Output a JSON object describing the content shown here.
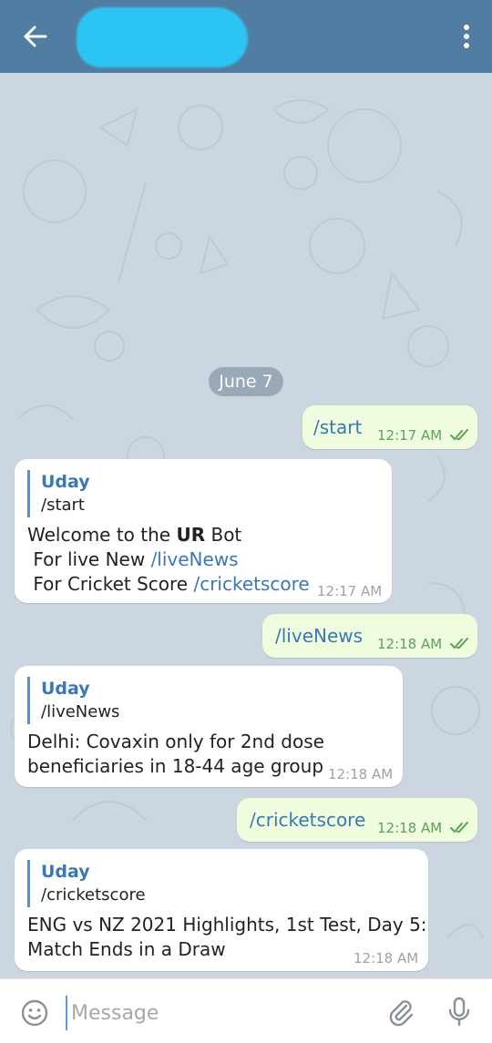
{
  "header": {
    "back_icon": "arrow-left-icon",
    "menu_icon": "more-vertical-icon",
    "color": "#517da2"
  },
  "chat": {
    "date_badge": "June 7",
    "messages": [
      {
        "direction": "out",
        "text": "/start",
        "time": "12:17 AM"
      },
      {
        "direction": "in",
        "reply_name": "Uday",
        "reply_text": "/start",
        "line1_prefix": "Welcome to the ",
        "line1_bold": "UR",
        "line1_suffix": " Bot",
        "line2_prefix": " For live New ",
        "line2_cmd": "/liveNews",
        "line3_prefix": " For Cricket Score ",
        "line3_cmd": "/cricketscore",
        "time": "12:17 AM"
      },
      {
        "direction": "out",
        "text": "/liveNews",
        "time": "12:18 AM"
      },
      {
        "direction": "in",
        "reply_name": "Uday",
        "reply_text": "/liveNews",
        "line1": "Delhi: Covaxin only for 2nd dose",
        "line2": "beneficiaries in 18-44 age group",
        "time": "12:18 AM"
      },
      {
        "direction": "out",
        "text": "/cricketscore",
        "time": "12:18 AM"
      },
      {
        "direction": "in",
        "reply_name": "Uday",
        "reply_text": "/cricketscore",
        "line1": "ENG vs NZ 2021 Highlights, 1st Test, Day 5:",
        "line2": "Match Ends in a Draw",
        "time": "12:18 AM"
      }
    ]
  },
  "composer": {
    "placeholder": "Message",
    "emoji_icon": "smile-icon",
    "attach_icon": "paperclip-icon",
    "mic_icon": "microphone-icon"
  },
  "colors": {
    "outgoing_bubble": "#effdde",
    "incoming_bubble": "#ffffff",
    "link": "#3a78b5",
    "read_ticks": "#5fa05c"
  }
}
